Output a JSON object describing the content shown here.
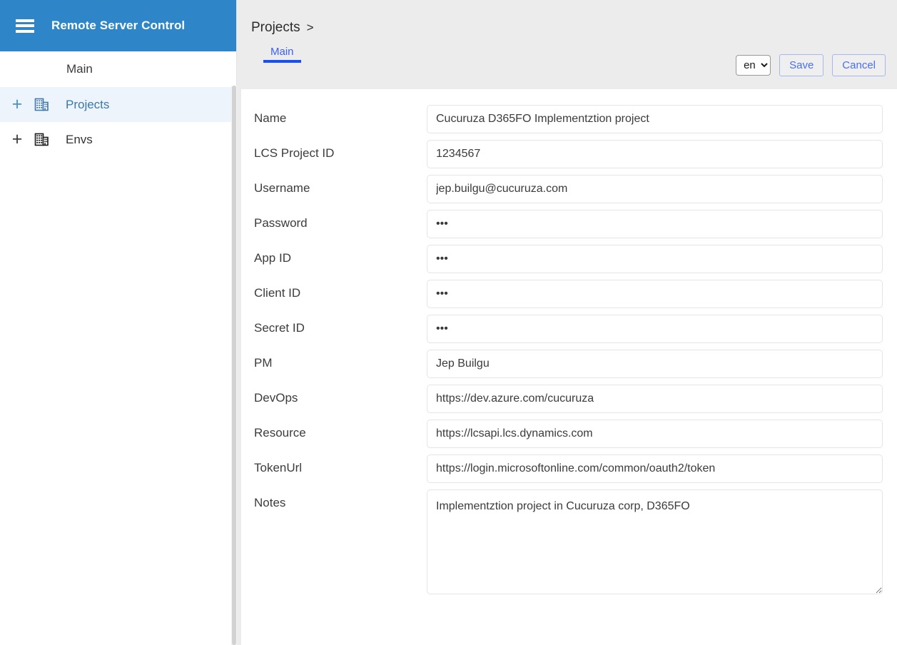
{
  "sidebar": {
    "brand_title": "Remote Server Control",
    "menu_icon": "hamburger-icon",
    "main_item": "Main",
    "tree": [
      {
        "expand": "+",
        "icon": "building-icon",
        "label": "Projects",
        "selected": true
      },
      {
        "expand": "+",
        "icon": "building-icon",
        "label": "Envs",
        "selected": false
      }
    ]
  },
  "topbar": {
    "breadcrumb": {
      "crumb": "Projects",
      "separator": ">"
    },
    "tabs": [
      {
        "label": "Main",
        "active": true
      }
    ],
    "language": {
      "selected": "en",
      "options": [
        "en"
      ]
    },
    "save_label": "Save",
    "cancel_label": "Cancel"
  },
  "form": {
    "fields": [
      {
        "label": "Name",
        "type": "text",
        "value": "Cucuruza D365FO Implementztion project",
        "name": "name"
      },
      {
        "label": "LCS Project ID",
        "type": "text",
        "value": "1234567",
        "name": "lcs-project-id"
      },
      {
        "label": "Username",
        "type": "text",
        "value": "jep.builgu@cucuruza.com",
        "name": "username"
      },
      {
        "label": "Password",
        "type": "password",
        "value": "•••",
        "name": "password"
      },
      {
        "label": "App ID",
        "type": "password",
        "value": "•••",
        "name": "app-id"
      },
      {
        "label": "Client ID",
        "type": "password",
        "value": "•••",
        "name": "client-id"
      },
      {
        "label": "Secret ID",
        "type": "password",
        "value": "•••",
        "name": "secret-id"
      },
      {
        "label": "PM",
        "type": "text",
        "value": "Jep Builgu",
        "name": "pm"
      },
      {
        "label": "DevOps",
        "type": "text",
        "value": "https://dev.azure.com/cucuruza",
        "name": "devops"
      },
      {
        "label": "Resource",
        "type": "text",
        "value": "https://lcsapi.lcs.dynamics.com",
        "name": "resource"
      },
      {
        "label": "TokenUrl",
        "type": "text",
        "value": "https://login.microsoftonline.com/common/oauth2/token",
        "name": "token-url"
      },
      {
        "label": "Notes",
        "type": "textarea",
        "value": "Implementztion project in Cucuruza corp, D365FO",
        "name": "notes"
      }
    ]
  },
  "colors": {
    "header_blue": "#2e86c8",
    "tab_blue": "#1b4ef0",
    "link_blue": "#3f5ef5",
    "selected_row": "#eef4fb",
    "page_bg": "#ececec",
    "panel_bg": "#ffffff"
  }
}
